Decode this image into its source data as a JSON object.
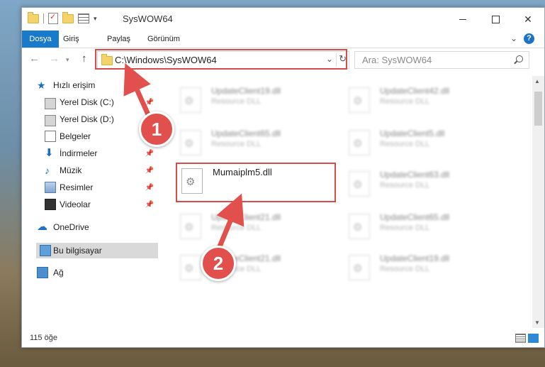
{
  "window": {
    "title": "SysWOW64"
  },
  "ribbon": {
    "tabs": [
      "Dosya",
      "Giriş",
      "Paylaş",
      "Görünüm"
    ],
    "help": "?"
  },
  "navigation": {
    "address": "C:\\Windows\\SysWOW64",
    "search_placeholder": "Ara: SysWOW64"
  },
  "sidebar": {
    "items": [
      {
        "label": "Hızlı erişim",
        "icon": "star-icon"
      },
      {
        "label": "Yerel Disk (C:)",
        "icon": "disk-icon",
        "pinned": true
      },
      {
        "label": "Yerel Disk (D:)",
        "icon": "disk-icon"
      },
      {
        "label": "Belgeler",
        "icon": "documents-icon"
      },
      {
        "label": "İndirmeler",
        "icon": "downloads-icon",
        "pinned": true
      },
      {
        "label": "Müzik",
        "icon": "music-icon",
        "pinned": true
      },
      {
        "label": "Resimler",
        "icon": "pictures-icon",
        "pinned": true
      },
      {
        "label": "Videolar",
        "icon": "videos-icon",
        "pinned": true
      },
      {
        "label": "OneDrive",
        "icon": "onedrive-icon"
      },
      {
        "label": "Bu bilgisayar",
        "icon": "this-pc-icon",
        "selected": true
      },
      {
        "label": "Ağ",
        "icon": "network-icon"
      }
    ]
  },
  "files": [
    {
      "name": "UpdateClient19.dll",
      "type": "Resource DLL"
    },
    {
      "name": "UpdateClient42.dll",
      "type": "Resource DLL"
    },
    {
      "name": "UpdateClient65.dll",
      "type": "Resource DLL"
    },
    {
      "name": "UpdateClient5.dll",
      "type": "Resource DLL"
    },
    {
      "name": "Mumaiplm5.dll",
      "type": ""
    },
    {
      "name": "UpdateClient63.dll",
      "type": "Resource DLL"
    },
    {
      "name": "UpdateClient21.dll",
      "type": "Resource DLL"
    },
    {
      "name": "UpdateClient65.dll",
      "type": "Resource DLL"
    },
    {
      "name": "UpdateClient21.dll",
      "type": "Resource DLL"
    },
    {
      "name": "UpdateClient19.dll",
      "type": "Resource DLL"
    }
  ],
  "status": {
    "item_count": "115 öğe"
  },
  "annotations": {
    "step1": "1",
    "step2": "2",
    "color": "#e2504d"
  },
  "colors": {
    "accent": "#1979ca",
    "highlight": "#d84b4b"
  }
}
